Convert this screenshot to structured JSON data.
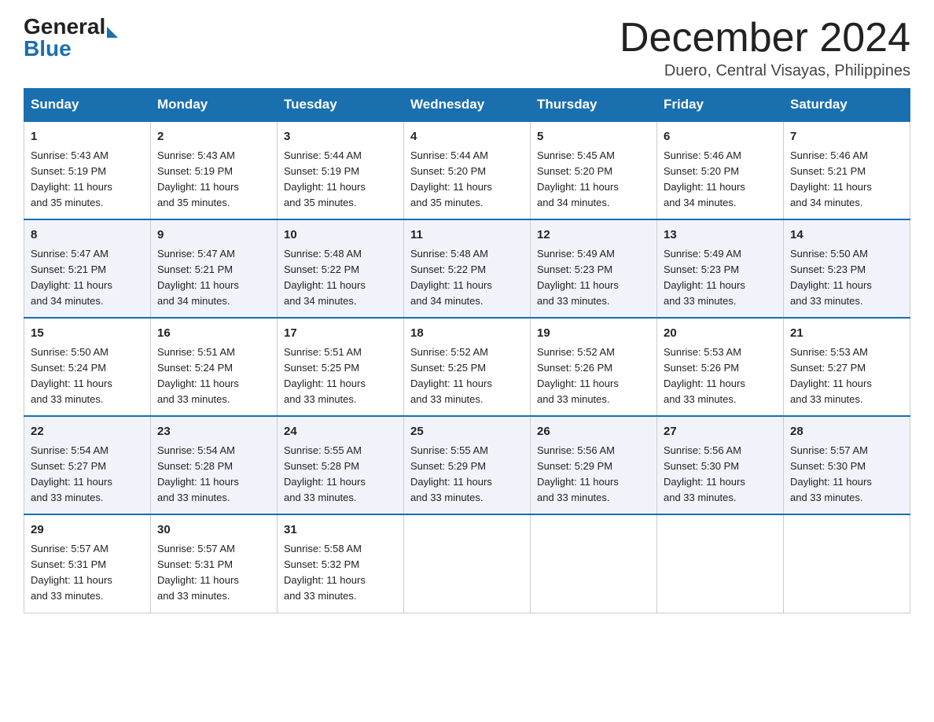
{
  "header": {
    "logo": {
      "general": "General",
      "blue": "Blue"
    },
    "title": "December 2024",
    "location": "Duero, Central Visayas, Philippines"
  },
  "calendar": {
    "days_of_week": [
      "Sunday",
      "Monday",
      "Tuesday",
      "Wednesday",
      "Thursday",
      "Friday",
      "Saturday"
    ],
    "weeks": [
      [
        {
          "day": "1",
          "sunrise": "5:43 AM",
          "sunset": "5:19 PM",
          "daylight": "11 hours and 35 minutes."
        },
        {
          "day": "2",
          "sunrise": "5:43 AM",
          "sunset": "5:19 PM",
          "daylight": "11 hours and 35 minutes."
        },
        {
          "day": "3",
          "sunrise": "5:44 AM",
          "sunset": "5:19 PM",
          "daylight": "11 hours and 35 minutes."
        },
        {
          "day": "4",
          "sunrise": "5:44 AM",
          "sunset": "5:20 PM",
          "daylight": "11 hours and 35 minutes."
        },
        {
          "day": "5",
          "sunrise": "5:45 AM",
          "sunset": "5:20 PM",
          "daylight": "11 hours and 34 minutes."
        },
        {
          "day": "6",
          "sunrise": "5:46 AM",
          "sunset": "5:20 PM",
          "daylight": "11 hours and 34 minutes."
        },
        {
          "day": "7",
          "sunrise": "5:46 AM",
          "sunset": "5:21 PM",
          "daylight": "11 hours and 34 minutes."
        }
      ],
      [
        {
          "day": "8",
          "sunrise": "5:47 AM",
          "sunset": "5:21 PM",
          "daylight": "11 hours and 34 minutes."
        },
        {
          "day": "9",
          "sunrise": "5:47 AM",
          "sunset": "5:21 PM",
          "daylight": "11 hours and 34 minutes."
        },
        {
          "day": "10",
          "sunrise": "5:48 AM",
          "sunset": "5:22 PM",
          "daylight": "11 hours and 34 minutes."
        },
        {
          "day": "11",
          "sunrise": "5:48 AM",
          "sunset": "5:22 PM",
          "daylight": "11 hours and 34 minutes."
        },
        {
          "day": "12",
          "sunrise": "5:49 AM",
          "sunset": "5:23 PM",
          "daylight": "11 hours and 33 minutes."
        },
        {
          "day": "13",
          "sunrise": "5:49 AM",
          "sunset": "5:23 PM",
          "daylight": "11 hours and 33 minutes."
        },
        {
          "day": "14",
          "sunrise": "5:50 AM",
          "sunset": "5:23 PM",
          "daylight": "11 hours and 33 minutes."
        }
      ],
      [
        {
          "day": "15",
          "sunrise": "5:50 AM",
          "sunset": "5:24 PM",
          "daylight": "11 hours and 33 minutes."
        },
        {
          "day": "16",
          "sunrise": "5:51 AM",
          "sunset": "5:24 PM",
          "daylight": "11 hours and 33 minutes."
        },
        {
          "day": "17",
          "sunrise": "5:51 AM",
          "sunset": "5:25 PM",
          "daylight": "11 hours and 33 minutes."
        },
        {
          "day": "18",
          "sunrise": "5:52 AM",
          "sunset": "5:25 PM",
          "daylight": "11 hours and 33 minutes."
        },
        {
          "day": "19",
          "sunrise": "5:52 AM",
          "sunset": "5:26 PM",
          "daylight": "11 hours and 33 minutes."
        },
        {
          "day": "20",
          "sunrise": "5:53 AM",
          "sunset": "5:26 PM",
          "daylight": "11 hours and 33 minutes."
        },
        {
          "day": "21",
          "sunrise": "5:53 AM",
          "sunset": "5:27 PM",
          "daylight": "11 hours and 33 minutes."
        }
      ],
      [
        {
          "day": "22",
          "sunrise": "5:54 AM",
          "sunset": "5:27 PM",
          "daylight": "11 hours and 33 minutes."
        },
        {
          "day": "23",
          "sunrise": "5:54 AM",
          "sunset": "5:28 PM",
          "daylight": "11 hours and 33 minutes."
        },
        {
          "day": "24",
          "sunrise": "5:55 AM",
          "sunset": "5:28 PM",
          "daylight": "11 hours and 33 minutes."
        },
        {
          "day": "25",
          "sunrise": "5:55 AM",
          "sunset": "5:29 PM",
          "daylight": "11 hours and 33 minutes."
        },
        {
          "day": "26",
          "sunrise": "5:56 AM",
          "sunset": "5:29 PM",
          "daylight": "11 hours and 33 minutes."
        },
        {
          "day": "27",
          "sunrise": "5:56 AM",
          "sunset": "5:30 PM",
          "daylight": "11 hours and 33 minutes."
        },
        {
          "day": "28",
          "sunrise": "5:57 AM",
          "sunset": "5:30 PM",
          "daylight": "11 hours and 33 minutes."
        }
      ],
      [
        {
          "day": "29",
          "sunrise": "5:57 AM",
          "sunset": "5:31 PM",
          "daylight": "11 hours and 33 minutes."
        },
        {
          "day": "30",
          "sunrise": "5:57 AM",
          "sunset": "5:31 PM",
          "daylight": "11 hours and 33 minutes."
        },
        {
          "day": "31",
          "sunrise": "5:58 AM",
          "sunset": "5:32 PM",
          "daylight": "11 hours and 33 minutes."
        },
        null,
        null,
        null,
        null
      ]
    ],
    "labels": {
      "sunrise": "Sunrise:",
      "sunset": "Sunset:",
      "daylight": "Daylight:"
    }
  }
}
